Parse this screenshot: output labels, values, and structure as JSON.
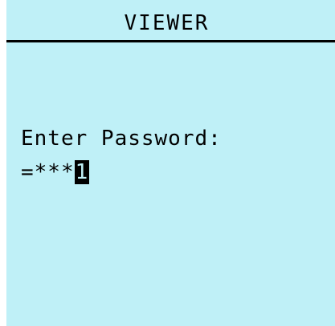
{
  "screen": {
    "title": "VIEWER",
    "prompt_label": "Enter Password:",
    "password_prefix": "=",
    "password_masked": "***",
    "password_cursor_char": "1"
  },
  "colors": {
    "lcd_background": "#bff0f7",
    "text": "#000000"
  }
}
